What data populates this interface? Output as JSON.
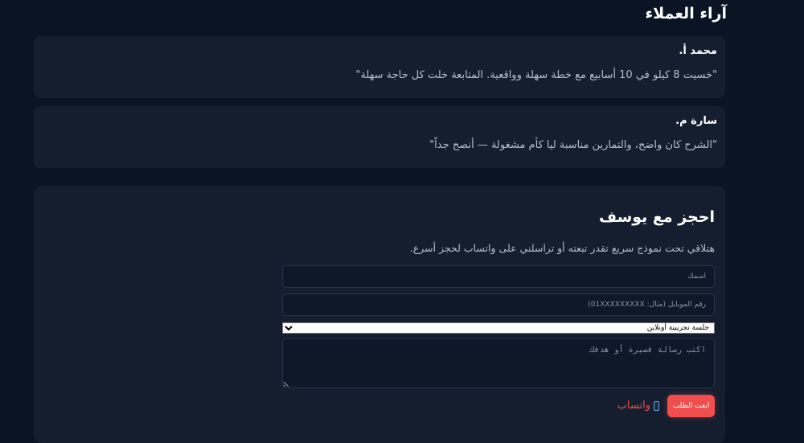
{
  "reviews_section": {
    "title": "آراء العملاء",
    "items": [
      {
        "name": "محمد أ.",
        "text": "\"خسيت 8 كيلو في 10 أسابيع مع خطة سهلة وواقعية. المتابعة خلت كل حاجة سهلة\""
      },
      {
        "name": "سارة م.",
        "text": "\"الشرح كان واضح، والتمارين مناسبة ليا كأم مشغولة — أنصح جداً\""
      }
    ]
  },
  "booking": {
    "title": "احجز مع يوسف",
    "subtitle": "هتلاقي تحت نموذج سريع تقدر تبعته أو تراسلني على واتساب لحجز أسرع.",
    "name_placeholder": "اسمك",
    "phone_placeholder": "رقم الموبايل (مثال: 01XXXXXXXXX)",
    "session_options": [
      "جلسة تجريبية أونلاين"
    ],
    "session_selected": "جلسة تجريبية أونلاين",
    "message_placeholder": "اكتب رسالة قصيرة أو هدفك",
    "submit_label": "ابعت الطلب",
    "whatsapp_label": "واتساب",
    "whatsapp_icon": "mobile-phone-icon"
  },
  "colors": {
    "background": "#0b1424",
    "card": "#141e2e",
    "accent": "#f04e4e"
  }
}
